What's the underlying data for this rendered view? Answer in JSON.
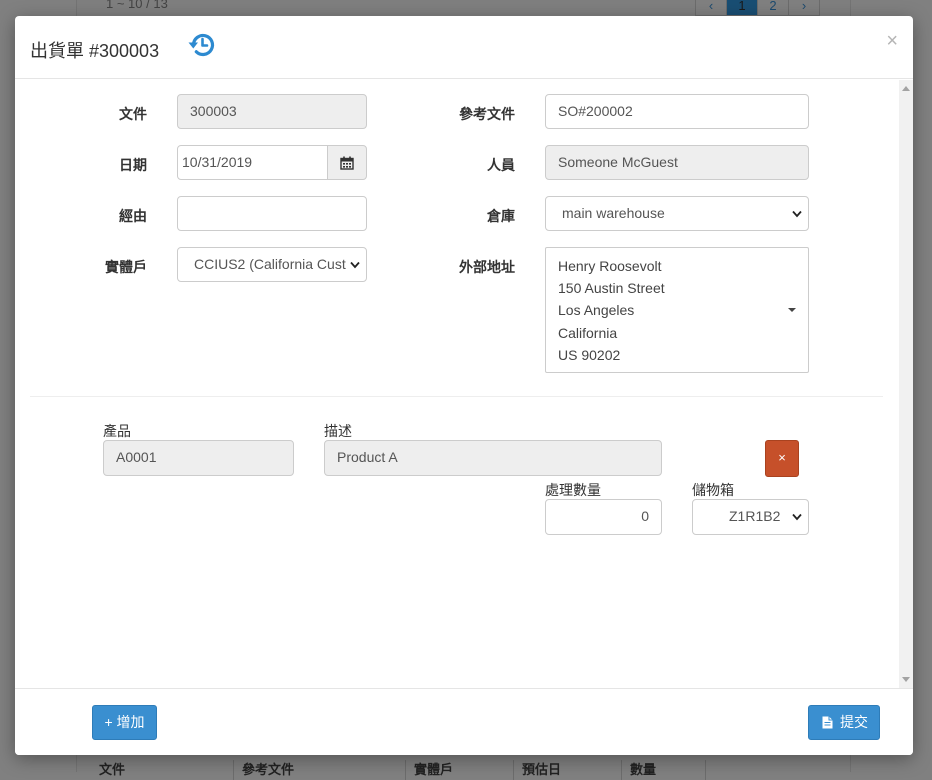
{
  "background": {
    "range_text": "1 ~ 10 / 13",
    "pager": [
      "‹",
      "1",
      "2",
      "›"
    ],
    "pager_active": "1",
    "table_headers": [
      "文件",
      "參考文件",
      "實體戶",
      "預估日",
      "數量"
    ]
  },
  "modal": {
    "title": "出貨單 #300003",
    "close_symbol": "×",
    "history_icon": "history-icon"
  },
  "form": {
    "document": {
      "label": "文件",
      "value": "300003"
    },
    "reference": {
      "label": "參考文件",
      "value": "SO#200002"
    },
    "date": {
      "label": "日期",
      "value": "10/31/2019",
      "icon": "calendar-icon"
    },
    "person": {
      "label": "人員",
      "value": "Someone McGuest"
    },
    "via": {
      "label": "經由",
      "value": ""
    },
    "warehouse": {
      "label": "倉庫",
      "value": "main warehouse"
    },
    "entity": {
      "label": "實體戶",
      "value": "CCIUS2 (California Cust"
    },
    "external_address": {
      "label": "外部地址",
      "lines": [
        "Henry Roosevolt",
        "150 Austin Street",
        "Los Angeles",
        "California",
        "US 90202"
      ]
    }
  },
  "line_item": {
    "product_label": "產品",
    "product_value": "A0001",
    "description_label": "描述",
    "description_value": "Product A",
    "remove_symbol": "×",
    "qty_label": "處理數量",
    "qty_value": "0",
    "bin_label": "儲物箱",
    "bin_value": "Z1R1B2"
  },
  "footer": {
    "add_label": "+ 增加",
    "submit_label": "提交",
    "submit_icon": "file-icon"
  },
  "colors": {
    "primary": "#3a8fd0",
    "danger": "#c6502a",
    "history_icon": "#2d8ad0"
  }
}
